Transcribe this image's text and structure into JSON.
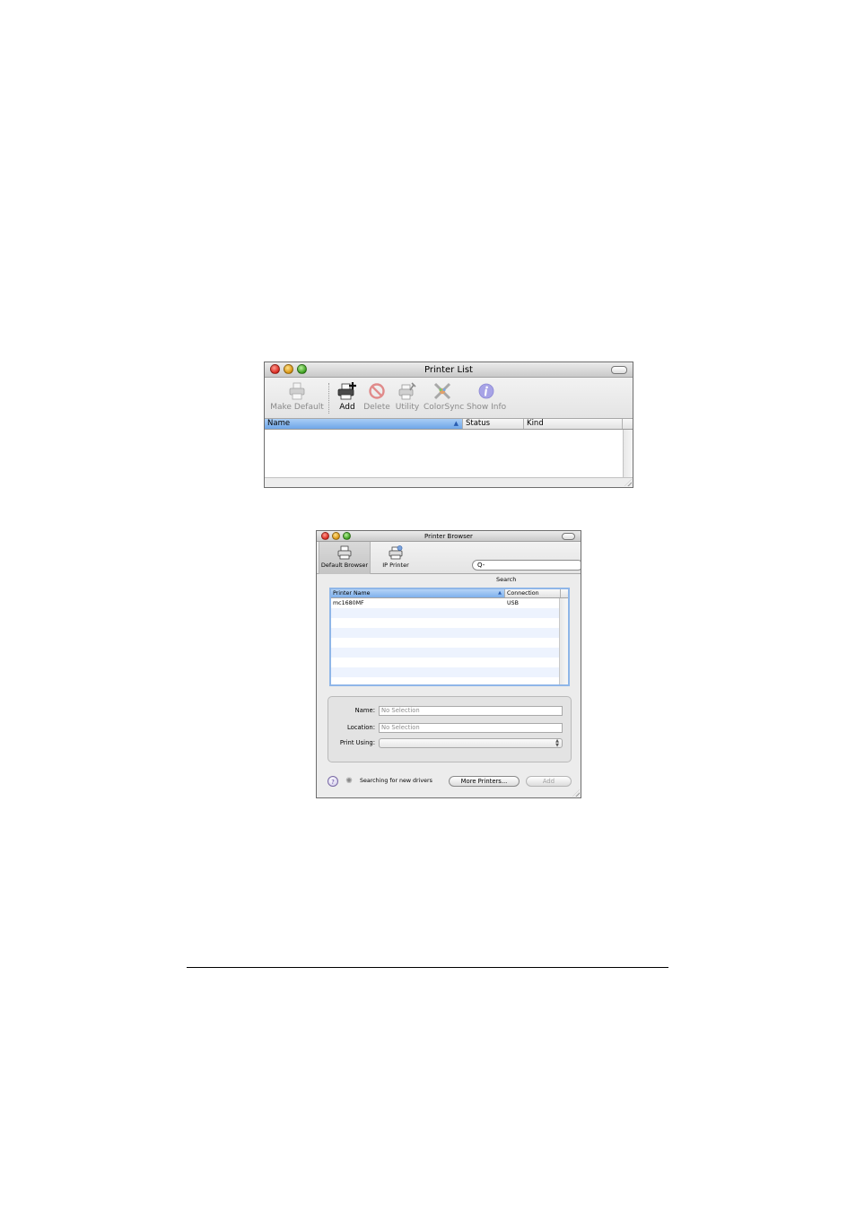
{
  "printer_list": {
    "title": "Printer List",
    "toolbar": {
      "make_default": "Make Default",
      "add": "Add",
      "delete": "Delete",
      "utility": "Utility",
      "colorsync": "ColorSync",
      "show_info": "Show Info"
    },
    "columns": {
      "name": "Name",
      "status": "Status",
      "kind": "Kind"
    }
  },
  "printer_browser": {
    "title": "Printer Browser",
    "toolbar": {
      "default_browser": "Default Browser",
      "ip_printer": "IP Printer",
      "search_placeholder": "Q-",
      "search_label": "Search"
    },
    "columns": {
      "printer_name": "Printer Name",
      "connection": "Connection"
    },
    "rows": [
      {
        "name": "mc1680MF",
        "connection": "USB"
      }
    ],
    "fields": {
      "name_label": "Name:",
      "name_value": "No Selection",
      "location_label": "Location:",
      "location_value": "No Selection",
      "print_using_label": "Print Using:"
    },
    "footer": {
      "help": "?",
      "searching_text": "Searching for new drivers",
      "more_printers": "More Printers...",
      "add": "Add"
    }
  }
}
